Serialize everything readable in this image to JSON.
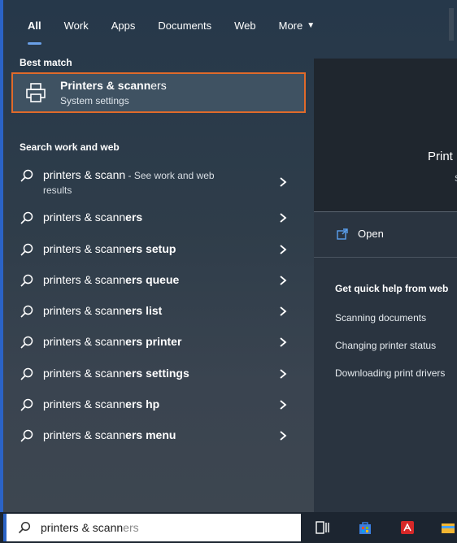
{
  "tabs": [
    {
      "label": "All",
      "active": true
    },
    {
      "label": "Work"
    },
    {
      "label": "Apps"
    },
    {
      "label": "Documents"
    },
    {
      "label": "Web"
    },
    {
      "label": "More"
    }
  ],
  "best_match": {
    "header": "Best match",
    "title_bold": "Printers & scann",
    "title_rest": "ers",
    "subtitle": "System settings"
  },
  "search_section": {
    "header": "Search work and web",
    "items": [
      {
        "prefix": "printers & scann",
        "bold": "",
        "suffix": " - See work and web",
        "line2": "results"
      },
      {
        "prefix": "printers & scann",
        "bold": "ers"
      },
      {
        "prefix": "printers & scann",
        "bold": "ers setup"
      },
      {
        "prefix": "printers & scann",
        "bold": "ers queue"
      },
      {
        "prefix": "printers & scann",
        "bold": "ers list"
      },
      {
        "prefix": "printers & scann",
        "bold": "ers printer"
      },
      {
        "prefix": "printers & scann",
        "bold": "ers settings"
      },
      {
        "prefix": "printers & scann",
        "bold": "ers hp"
      },
      {
        "prefix": "printers & scann",
        "bold": "ers menu"
      }
    ]
  },
  "preview": {
    "app_name": "Print",
    "subtitle": "S",
    "open_label": "Open",
    "help_header": "Get quick help from web",
    "help_links": [
      "Scanning documents",
      "Changing printer status",
      "Downloading print drivers"
    ]
  },
  "search_box": {
    "typed": "printers & scann",
    "completion": "ers"
  },
  "colors": {
    "accent": "#2b63c6",
    "selection_border": "#e06a2a"
  }
}
